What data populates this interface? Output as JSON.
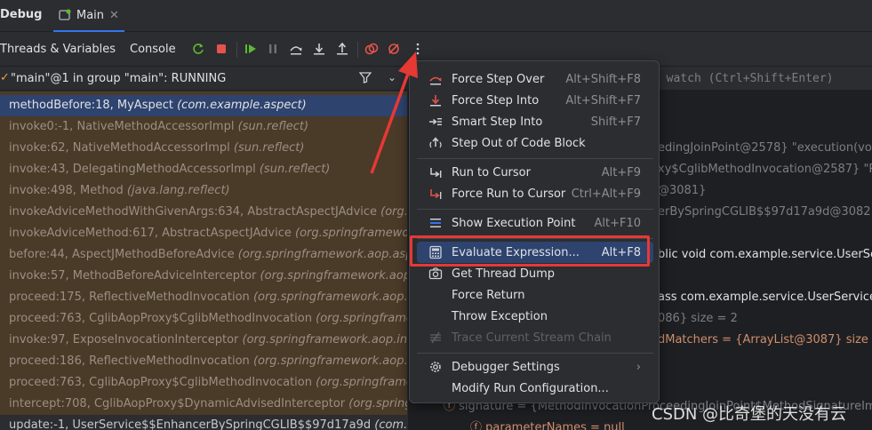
{
  "title_bar": {
    "debug_label": "Debug",
    "tab_label": "Main"
  },
  "toolbar": {
    "tab_threads": "Threads & Variables",
    "tab_console": "Console"
  },
  "thread": {
    "label": "\"main\"@1 in group \"main\": RUNNING"
  },
  "watch": {
    "placeholder": "a watch (Ctrl+Shift+Enter)"
  },
  "frames": [
    {
      "method": "methodBefore:18, MyAspect",
      "pkg": "(com.example.aspect)"
    },
    {
      "method": "invoke0:-1, NativeMethodAccessorImpl",
      "pkg": "(sun.reflect)"
    },
    {
      "method": "invoke:62, NativeMethodAccessorImpl",
      "pkg": "(sun.reflect)"
    },
    {
      "method": "invoke:43, DelegatingMethodAccessorImpl",
      "pkg": "(sun.reflect)"
    },
    {
      "method": "invoke:498, Method",
      "pkg": "(java.lang.reflect)"
    },
    {
      "method": "invokeAdviceMethodWithGivenArgs:634, AbstractAspectJAdvice",
      "pkg": "(org.s"
    },
    {
      "method": "invokeAdviceMethod:617, AbstractAspectJAdvice",
      "pkg": "(org.springframewo"
    },
    {
      "method": "before:44, AspectJMethodBeforeAdvice",
      "pkg": "(org.springframework.aop.asp"
    },
    {
      "method": "invoke:57, MethodBeforeAdviceInterceptor",
      "pkg": "(org.springframework.aop.f"
    },
    {
      "method": "proceed:175, ReflectiveMethodInvocation",
      "pkg": "(org.springframework.aop.fra"
    },
    {
      "method": "proceed:763, CglibAopProxy$CglibMethodInvocation",
      "pkg": "(org.springframew"
    },
    {
      "method": "invoke:97, ExposeInvocationInterceptor",
      "pkg": "(org.springframework.aop.inter"
    },
    {
      "method": "proceed:186, ReflectiveMethodInvocation",
      "pkg": "(org.springframework.aop.fra"
    },
    {
      "method": "proceed:763, CglibAopProxy$CglibMethodInvocation",
      "pkg": "(org.springframew"
    },
    {
      "method": "intercept:708, CglibAopProxy$DynamicAdvisedInterceptor",
      "pkg": "(org.springfra"
    },
    {
      "method": "update:-1, UserService$$EnhancerBySpringCGLIB$$97d17a9d",
      "pkg": "(com.exa"
    }
  ],
  "variables": [
    "edingJoinPoint@2578} \"execution(void",
    "xy$CglibMethodInvocation@2587} \"Re",
    "@3081}",
    "erBySpringCGLIB$$97d17a9d@3082} \"",
    "blic void com.example.service.UserSer",
    "ass com.example.service.UserService\"",
    "086}  size = 2",
    "dMatchers = {ArrayList@3087}  size =",
    "signature = {MethodInvocationProceedingJoinPoint$MethodSignatureImpl",
    "parameterNames = null"
  ],
  "menu": {
    "items": [
      {
        "label": "Force Step Over",
        "shortcut": "Alt+Shift+F8"
      },
      {
        "label": "Force Step Into",
        "shortcut": "Alt+Shift+F7"
      },
      {
        "label": "Smart Step Into",
        "shortcut": "Shift+F7"
      },
      {
        "label": "Step Out of Code Block",
        "shortcut": ""
      },
      {
        "label": "Run to Cursor",
        "shortcut": "Alt+F9"
      },
      {
        "label": "Force Run to Cursor",
        "shortcut": "Ctrl+Alt+F9"
      },
      {
        "label": "Show Execution Point",
        "shortcut": "Alt+F10"
      },
      {
        "label": "Evaluate Expression...",
        "shortcut": "Alt+F8"
      },
      {
        "label": "Get Thread Dump",
        "shortcut": ""
      },
      {
        "label": "Force Return",
        "shortcut": ""
      },
      {
        "label": "Throw Exception",
        "shortcut": ""
      },
      {
        "label": "Trace Current Stream Chain",
        "shortcut": ""
      },
      {
        "label": "Debugger Settings",
        "shortcut": ""
      },
      {
        "label": "Modify Run Configuration...",
        "shortcut": ""
      }
    ]
  },
  "watermark": "CSDN @比奇堡的天没有云",
  "colors": {
    "accent": "#3574f0",
    "highlight_box": "#e53935",
    "selection": "#2e436e",
    "frame_bg": "#4a3a28"
  }
}
